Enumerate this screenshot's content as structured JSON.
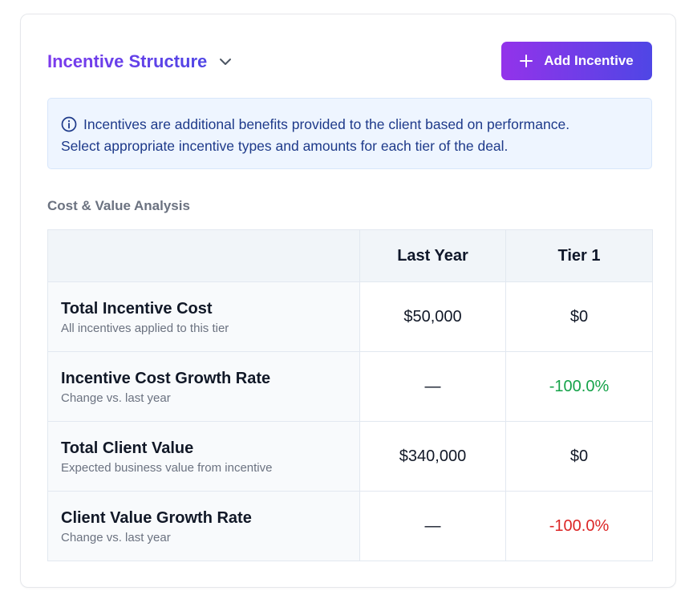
{
  "header": {
    "title": "Incentive Structure",
    "add_button_label": "Add Incentive"
  },
  "info": {
    "line1": "Incentives are additional benefits provided to the client based on performance.",
    "line2": "Select appropriate incentive types and amounts for each tier of the deal."
  },
  "section_label": "Cost & Value Analysis",
  "table": {
    "columns": [
      "",
      "Last Year",
      "Tier 1"
    ],
    "rows": [
      {
        "title": "Total Incentive Cost",
        "subtitle": "All incentives applied to this tier",
        "last_year": "$50,000",
        "tier1": "$0",
        "tier1_color": "default"
      },
      {
        "title": "Incentive Cost Growth Rate",
        "subtitle": "Change vs. last year",
        "last_year": "—",
        "tier1": "-100.0%",
        "tier1_color": "#16a34a"
      },
      {
        "title": "Total Client Value",
        "subtitle": "Expected business value from incentive",
        "last_year": "$340,000",
        "tier1": "$0",
        "tier1_color": "default"
      },
      {
        "title": "Client Value Growth Rate",
        "subtitle": "Change vs. last year",
        "last_year": "—",
        "tier1": "-100.0%",
        "tier1_color": "#dc2626"
      }
    ]
  },
  "colors": {
    "accent_start": "#9333ea",
    "accent_end": "#4f46e5",
    "info_bg": "#eef5ff",
    "info_text": "#1e3a8a",
    "positive": "#16a34a",
    "negative": "#dc2626"
  },
  "icons": {
    "chevron": "chevron-down-icon",
    "plus": "plus-icon",
    "info": "info-icon"
  }
}
